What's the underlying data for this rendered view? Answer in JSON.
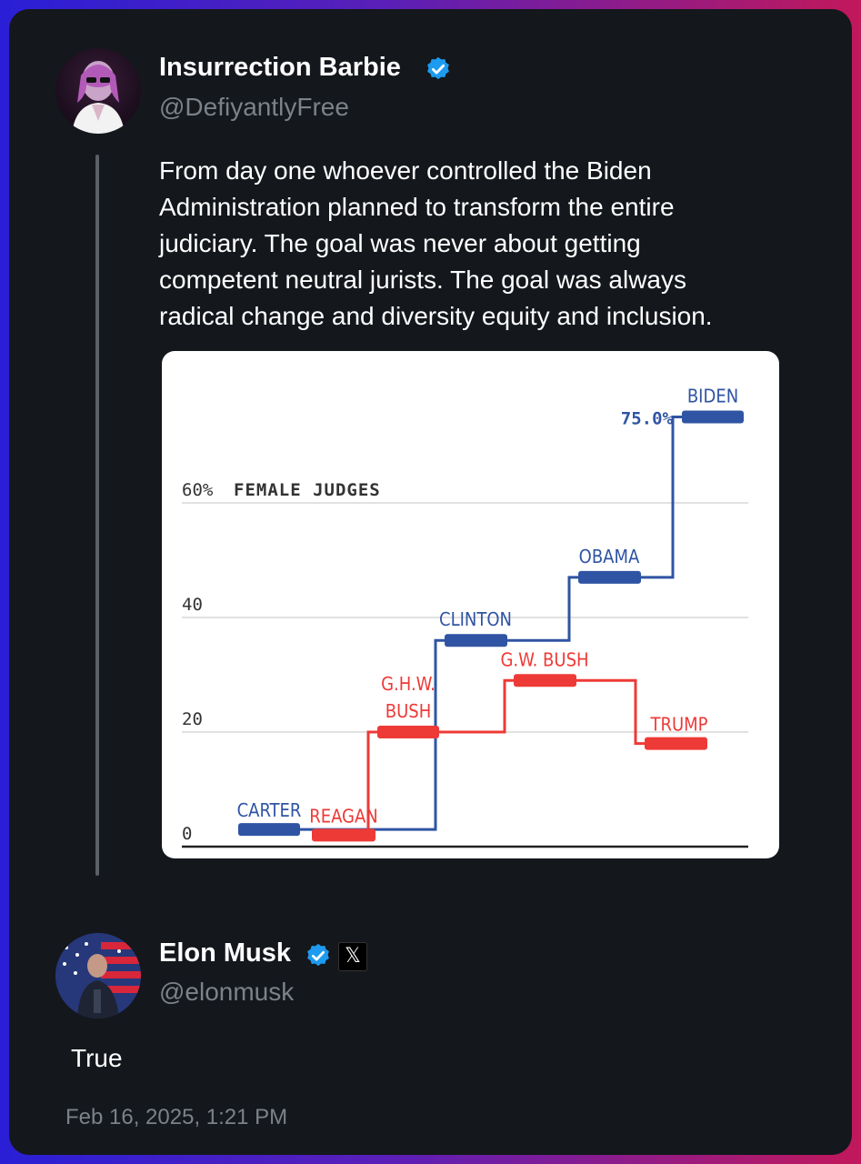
{
  "original_post": {
    "author_name": "Insurrection Barbie",
    "author_handle": "@DefiyantlyFree",
    "text_lines": [
      "From day one whoever controlled the Biden",
      "Administration planned to transform the entire",
      "judiciary. The goal was never about getting",
      "competent neutral jurists. The goal was always",
      "radical change and diversity equity and inclusion."
    ]
  },
  "reply_post": {
    "author_name": "Elon Musk",
    "author_handle": "@elonmusk",
    "text": "True",
    "timestamp": "Feb 16, 2025, 1:21 PM"
  },
  "icons": {
    "verified": "verified-badge-icon",
    "affiliation": "x-logo-icon"
  },
  "colors": {
    "verified_blue": "#1d9bf0",
    "democrat_blue": "#2f54a3",
    "republican_red": "#ee3a36"
  },
  "chart_data": {
    "type": "line",
    "title": "",
    "ylabel": "FEMALE JUDGES",
    "y_ticks": [
      "0",
      "20",
      "40",
      "60%"
    ],
    "ylim": [
      0,
      75
    ],
    "series": [
      {
        "name": "",
        "party": "D",
        "points": [
          {
            "label": "CARTER",
            "value": 3
          },
          {
            "label": "CLINTON",
            "value": 36
          },
          {
            "label": "OBAMA",
            "value": 47
          },
          {
            "label": "BIDEN",
            "value": 75.0
          }
        ]
      },
      {
        "name": "",
        "party": "R",
        "points": [
          {
            "label": "REAGAN",
            "value": 2
          },
          {
            "label": "G.H.W. BUSH",
            "value": 20
          },
          {
            "label": "G.W. BUSH",
            "value": 29
          },
          {
            "label": "TRUMP",
            "value": 18
          }
        ]
      }
    ],
    "annotations": [
      {
        "text": "75.0%",
        "for": "BIDEN"
      }
    ]
  }
}
